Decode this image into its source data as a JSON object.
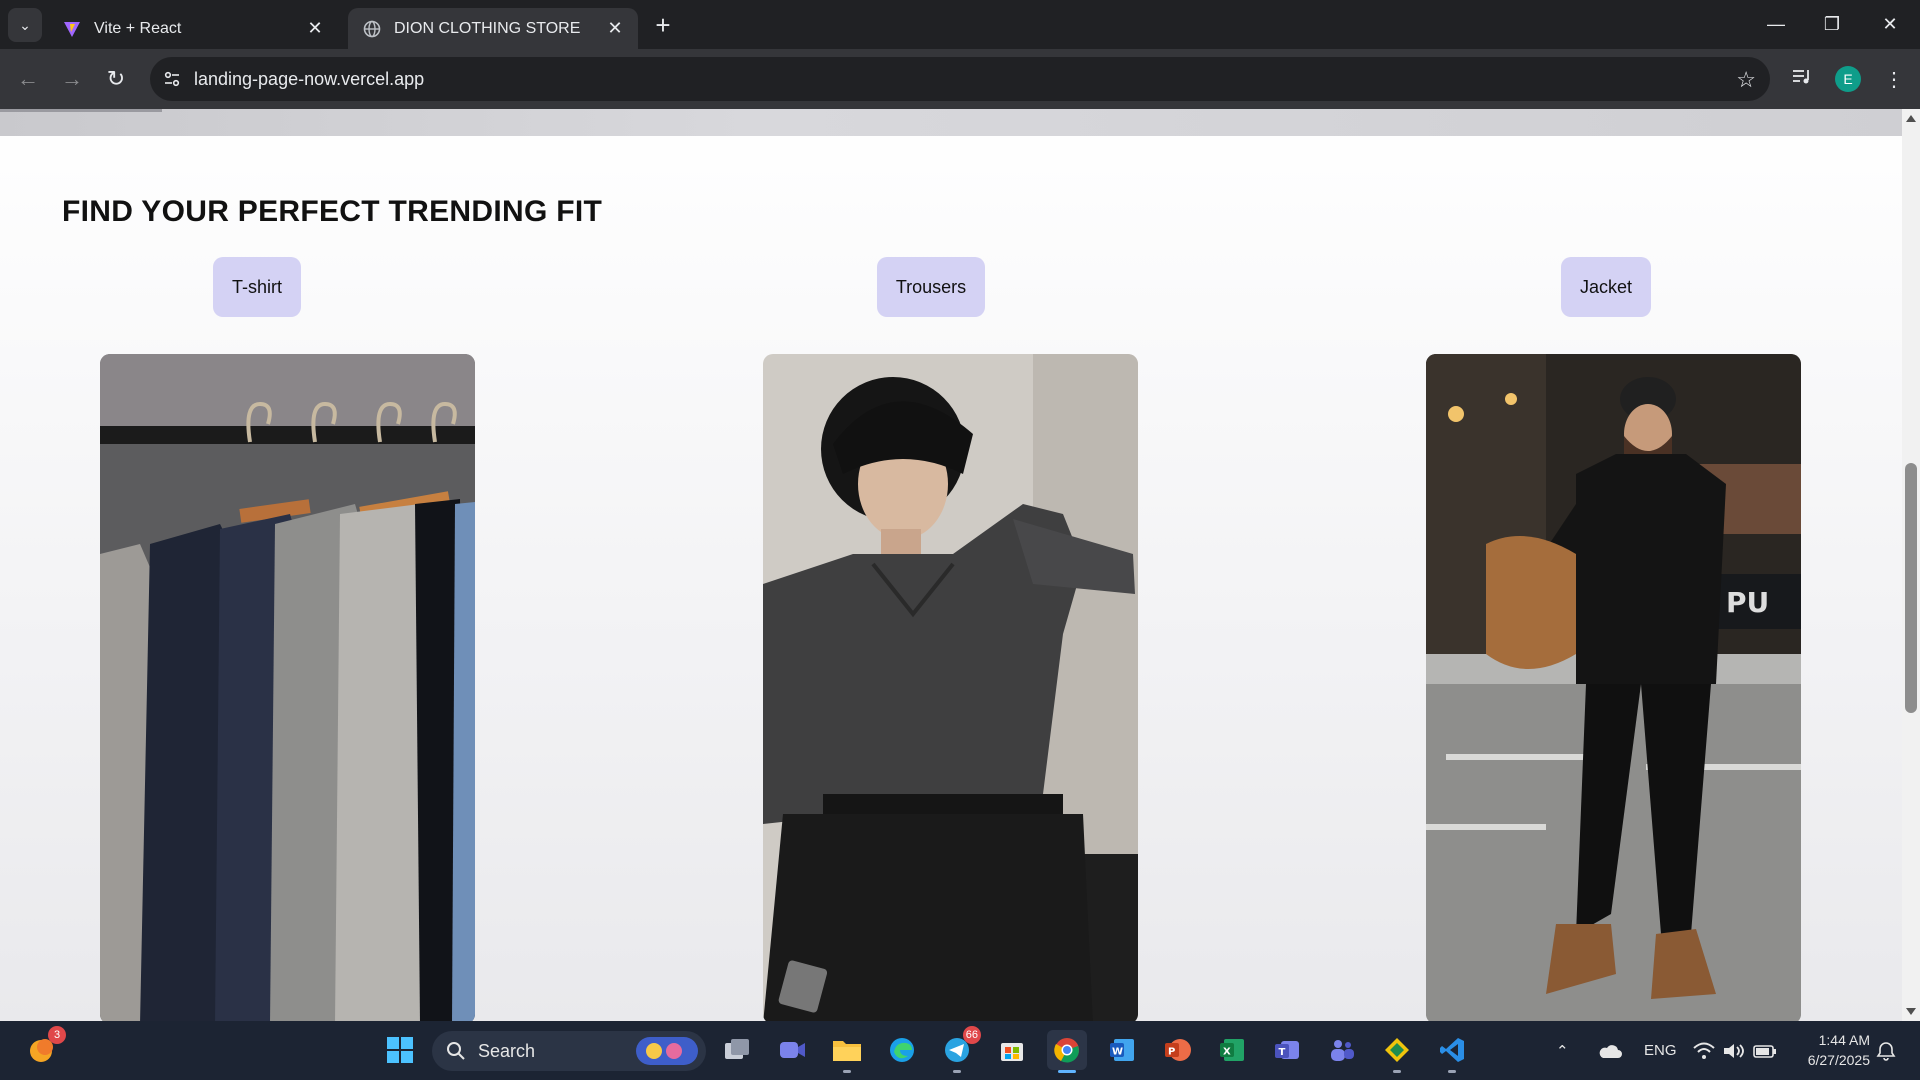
{
  "browser": {
    "tabs": [
      {
        "title": "Vite + React",
        "active": false
      },
      {
        "title": "DION CLOTHING STORE",
        "active": true
      }
    ],
    "url": "landing-page-now.vercel.app",
    "profile_initial": "E"
  },
  "page": {
    "section_title": "FIND YOUR PERFECT TRENDING FIT",
    "categories": [
      {
        "label": "T-shirt",
        "photo": "clothes-rack-suits"
      },
      {
        "label": "Trousers",
        "photo": "man-dark-shirt-seated"
      },
      {
        "label": "Jacket",
        "photo": "man-black-outfit-street"
      }
    ],
    "accent_color": "#d4d2f4"
  },
  "taskbar": {
    "search_label": "Search",
    "widget_badge": "3",
    "telegram_badge": "66",
    "language": "ENG",
    "time": "1:44 AM",
    "date": "6/27/2025"
  }
}
